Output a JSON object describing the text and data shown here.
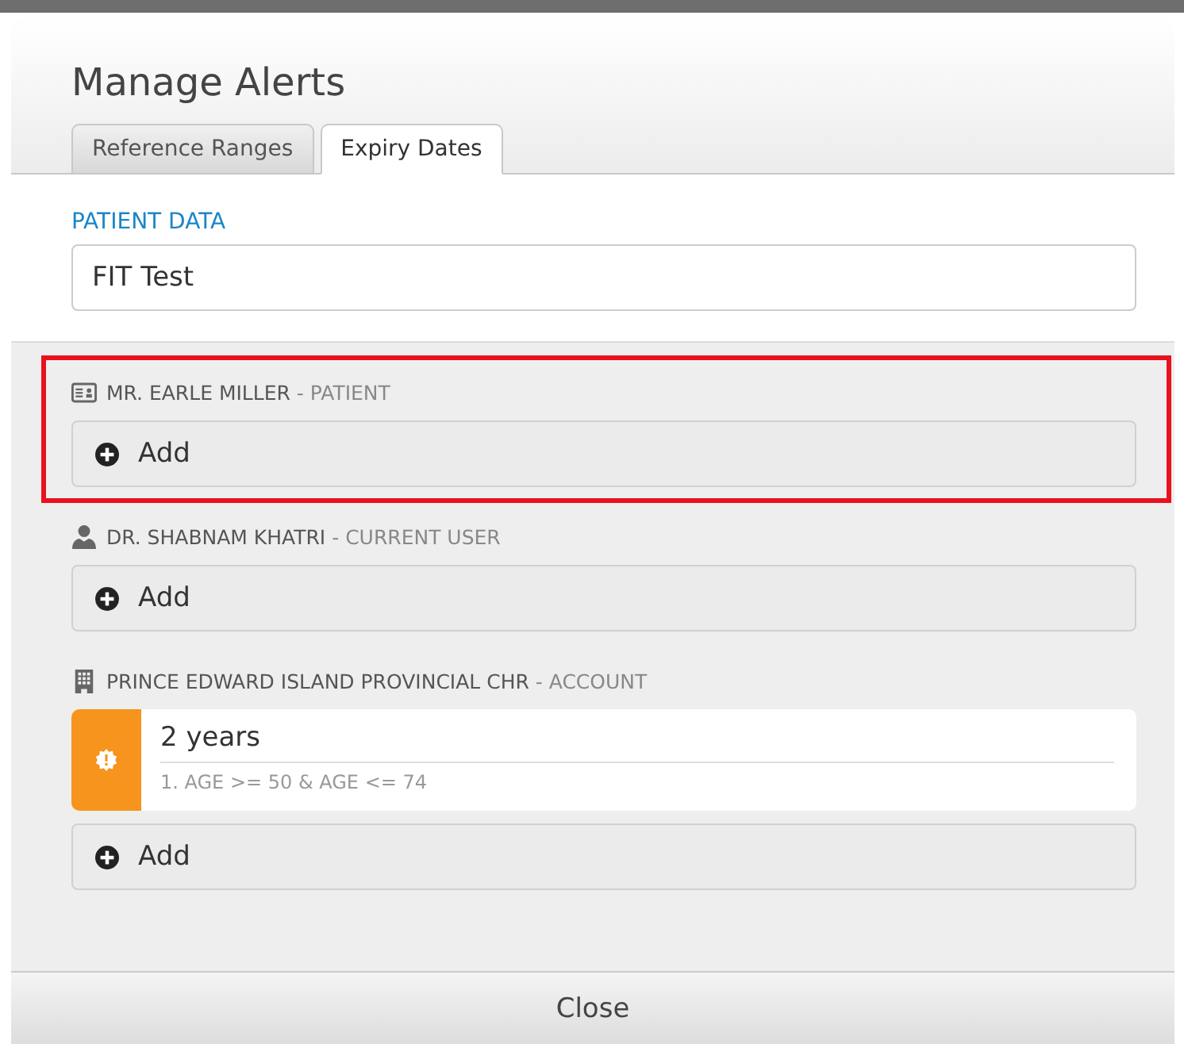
{
  "dialog": {
    "title": "Manage Alerts"
  },
  "tabs": [
    {
      "label": "Reference Ranges",
      "selected": false
    },
    {
      "label": "Expiry Dates",
      "selected": true
    }
  ],
  "patient_data": {
    "label": "PATIENT DATA",
    "value": "FIT Test"
  },
  "sections": [
    {
      "kind": "patient",
      "name": "MR. EARLE MILLER",
      "role": "- PATIENT",
      "highlighted": true,
      "add_label": "Add"
    },
    {
      "kind": "user",
      "name": "DR. SHABNAM KHATRI",
      "role": "- CURRENT USER",
      "highlighted": false,
      "add_label": "Add"
    },
    {
      "kind": "account",
      "name": "PRINCE EDWARD ISLAND PROVINCIAL CHR",
      "role": "- ACCOUNT",
      "highlighted": false,
      "alerts": [
        {
          "title": "2 years",
          "condition": "1. AGE >= 50 & AGE <= 74",
          "color": "#f7941d"
        }
      ],
      "add_label": "Add"
    }
  ],
  "footer": {
    "close_label": "Close"
  }
}
